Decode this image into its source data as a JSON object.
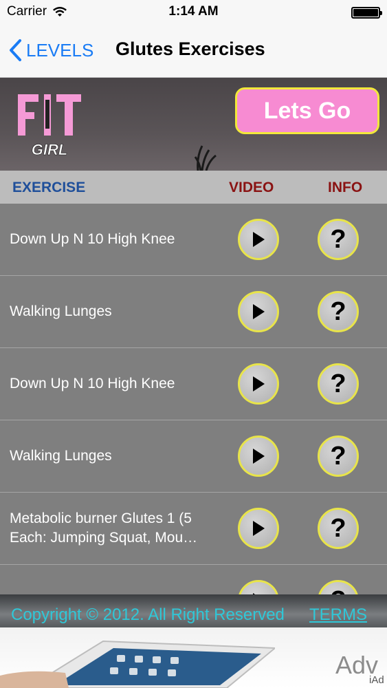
{
  "status_bar": {
    "carrier": "Carrier",
    "time": "1:14 AM"
  },
  "nav": {
    "back_label": "LEVELS",
    "title": "Glutes Exercises"
  },
  "banner": {
    "cta_label": "Lets Go",
    "logo_text": "FIT GIRL"
  },
  "table_header": {
    "exercise": "EXERCISE",
    "video": "VIDEO",
    "info": "INFO"
  },
  "rows": [
    {
      "label": "Down Up N 10 High Knee"
    },
    {
      "label": "Walking Lunges"
    },
    {
      "label": "Down Up N 10 High Knee"
    },
    {
      "label": "Walking Lunges"
    },
    {
      "label": "Metabolic burner Glutes 1 (5 Each: Jumping Squat, Mou…"
    }
  ],
  "footer": {
    "copyright": "Copyright © 2012. All Right Reserved",
    "terms": "TERMS"
  },
  "ad": {
    "text": "Adv",
    "iad": "iAd"
  },
  "icons": {
    "play": "play-icon",
    "info": "question-icon",
    "back": "chevron-left-icon",
    "wifi": "wifi-icon",
    "battery": "battery-icon"
  },
  "colors": {
    "accent": "#1a7cf5",
    "cta": "#f78bd2",
    "cta_border": "#f2e83a",
    "header_exercise": "#1f4f9a",
    "header_red": "#8a1313",
    "footer_text": "#2fc8d8"
  }
}
